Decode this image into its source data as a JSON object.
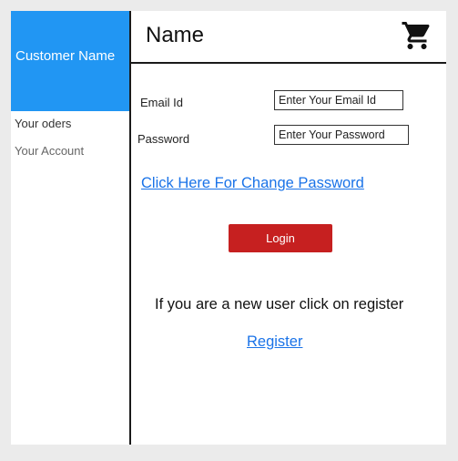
{
  "sidebar": {
    "customer_name": "Customer Name",
    "items": [
      {
        "label": "Your oders"
      },
      {
        "label": "Your Account"
      }
    ],
    "accent_color": "#2196f3"
  },
  "header": {
    "title": "Name",
    "cart_icon": "shopping-cart-icon"
  },
  "form": {
    "email_label": "Email Id",
    "email_placeholder": "Enter Your Email Id",
    "password_label": "Password",
    "password_placeholder": "Enter Your Password",
    "change_password_link": "Click Here For  Change Password",
    "login_button": "Login",
    "login_button_color": "#c62020",
    "new_user_text": "If you are a new user click on register",
    "register_link": "Register",
    "link_color": "#1a73e8"
  }
}
